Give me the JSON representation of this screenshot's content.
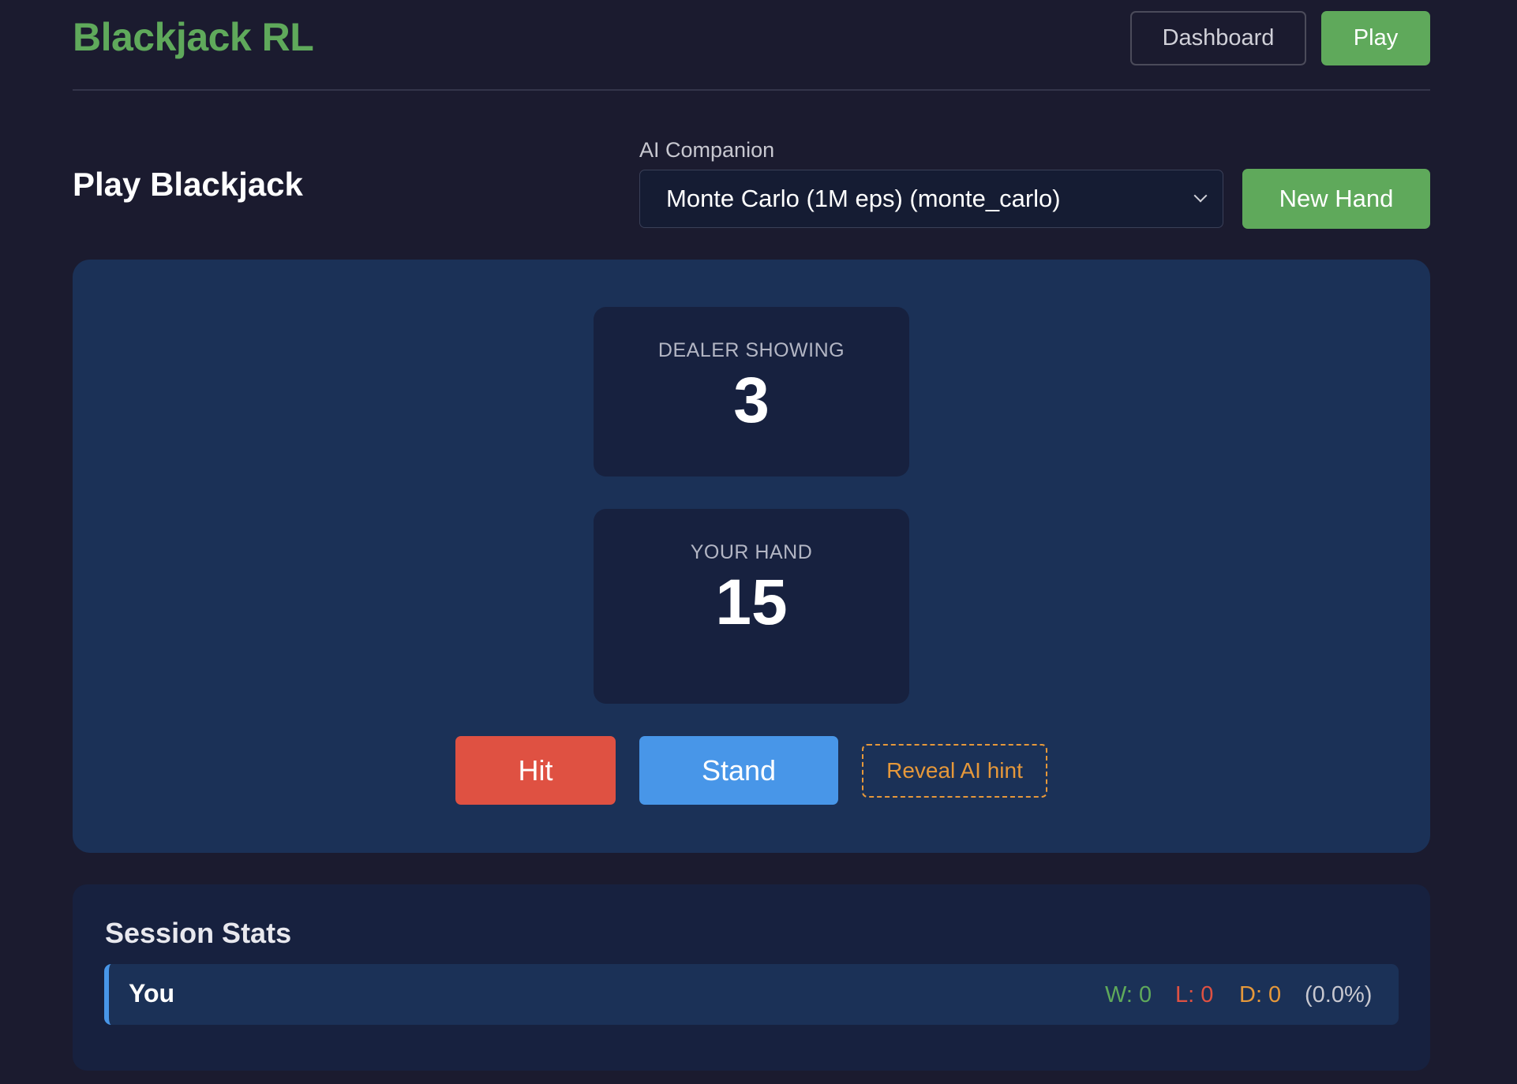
{
  "header": {
    "brand": "Blackjack RL",
    "nav": {
      "dashboard": "Dashboard",
      "play": "Play"
    }
  },
  "controls": {
    "page_title": "Play Blackjack",
    "companion_label": "AI Companion",
    "companion_selected": "Monte Carlo (1M eps) (monte_carlo)",
    "new_hand": "New Hand"
  },
  "table": {
    "dealer_label": "DEALER SHOWING",
    "dealer_value": "3",
    "player_label": "YOUR HAND",
    "player_value": "15",
    "hit": "Hit",
    "stand": "Stand",
    "hint": "Reveal AI hint"
  },
  "stats": {
    "title": "Session Stats",
    "rows": [
      {
        "name": "You",
        "wins": "W: 0",
        "losses": "L: 0",
        "draws": "D: 0",
        "pct": "(0.0%)"
      }
    ]
  },
  "colors": {
    "accent_green": "#5fa95b",
    "hit_red": "#df5142",
    "stand_blue": "#4896e8",
    "hint_orange": "#e6983a",
    "background": "#1b1b2f",
    "table": "#1b3157"
  }
}
